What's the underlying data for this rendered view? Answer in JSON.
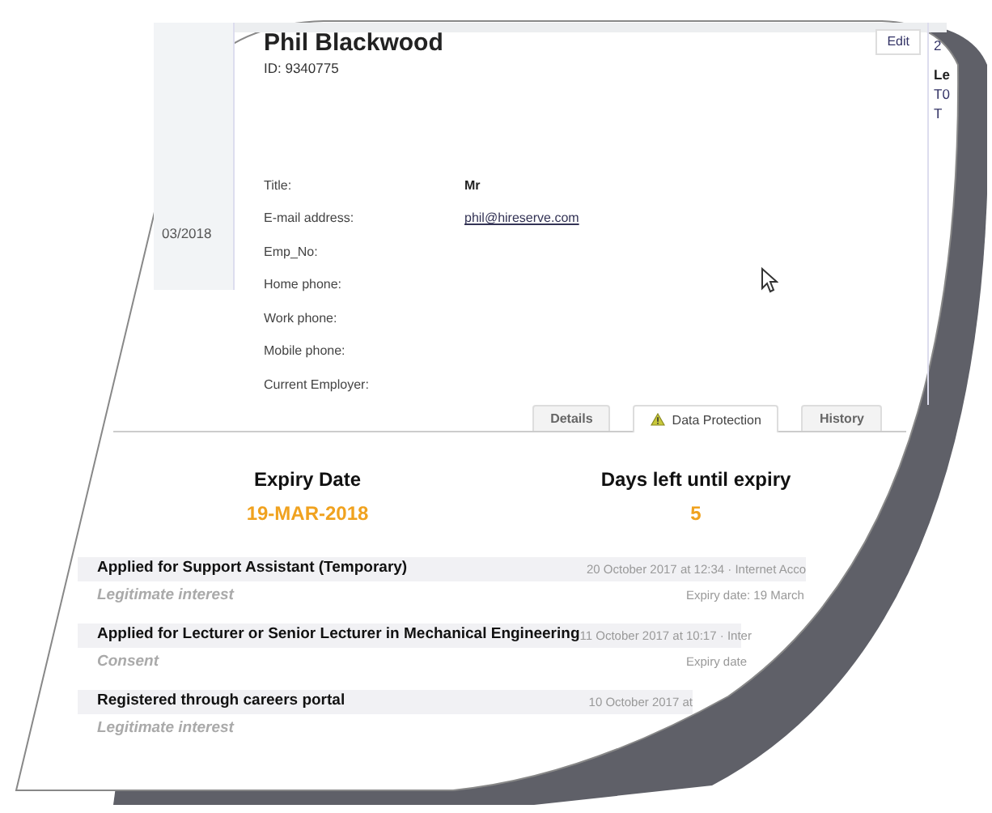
{
  "profile": {
    "name": "Phil Blackwood",
    "id_label": "ID: 9340775",
    "edit_button": "Edit"
  },
  "side_panel": {
    "date": "03/2018"
  },
  "right_panel": {
    "lines": [
      {
        "text": "2",
        "kind": "plain"
      },
      {
        "text": "Le",
        "kind": "heading"
      },
      {
        "text": "T0",
        "kind": "plain"
      },
      {
        "text": "T",
        "kind": "plain"
      }
    ]
  },
  "fields": [
    {
      "label": "Title:",
      "value": "Mr",
      "kind": "text"
    },
    {
      "label": "E-mail address:",
      "value": "phil@hireserve.com",
      "kind": "link"
    },
    {
      "label": "Emp_No:"
    },
    {
      "label": "Home phone:"
    },
    {
      "label": "Work phone:"
    },
    {
      "label": "Mobile phone:"
    },
    {
      "label": "Current Employer:"
    }
  ],
  "tabs": [
    {
      "label": "Details",
      "selected": false,
      "warning": false
    },
    {
      "label": "Data Protection",
      "selected": true,
      "warning": true
    },
    {
      "label": "History",
      "selected": false,
      "warning": false
    }
  ],
  "expiry": [
    {
      "heading": "Expiry Date",
      "value": "19-MAR-2018"
    },
    {
      "heading": "Days left until expiry",
      "value": "5"
    }
  ],
  "records": [
    {
      "title": "Applied for Support Assistant (Temporary)",
      "meta": "20 October 2017 at 12:34 · Internet Acco",
      "basis": "Legitimate interest",
      "expiry": "Expiry date: 19 March"
    },
    {
      "title": "Applied for Lecturer or Senior Lecturer in Mechanical Engineering",
      "meta": "11 October 2017 at 10:17 · Inter",
      "basis": "Consent",
      "expiry": "Expiry date"
    },
    {
      "title": "Registered through careers portal",
      "meta": "10 October 2017 at",
      "basis": "Legitimate interest"
    }
  ]
}
